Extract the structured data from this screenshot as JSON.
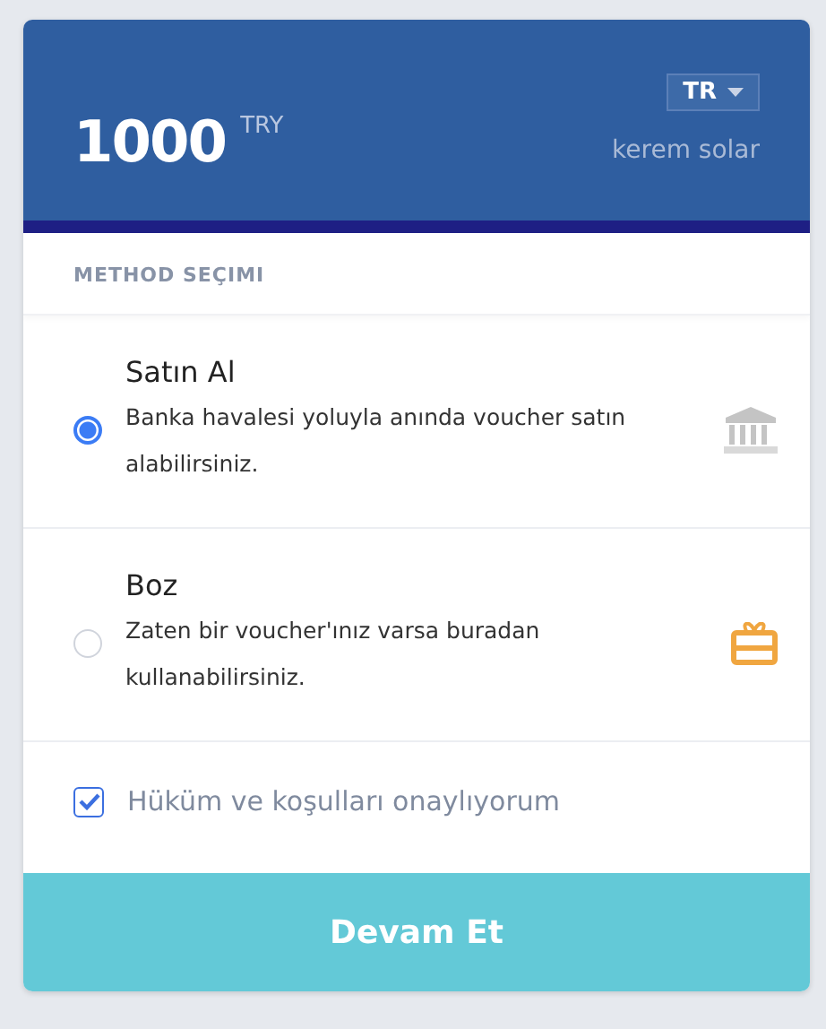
{
  "header": {
    "amount": "1000",
    "currency": "TRY",
    "language": "TR",
    "user": "kerem solar"
  },
  "section_title": "METHOD SEÇIMI",
  "methods": [
    {
      "title": "Satın Al",
      "description": "Banka havalesi yoluyla anında voucher satın alabilirsiniz.",
      "selected": true,
      "kind": "bank"
    },
    {
      "title": "Boz",
      "description": "Zaten bir voucher'ınız varsa buradan kullanabilirsiniz.",
      "selected": false,
      "kind": "gift"
    }
  ],
  "terms": {
    "label": "Hüküm ve koşulları onaylıyorum",
    "checked": true
  },
  "submit": "Devam Et"
}
